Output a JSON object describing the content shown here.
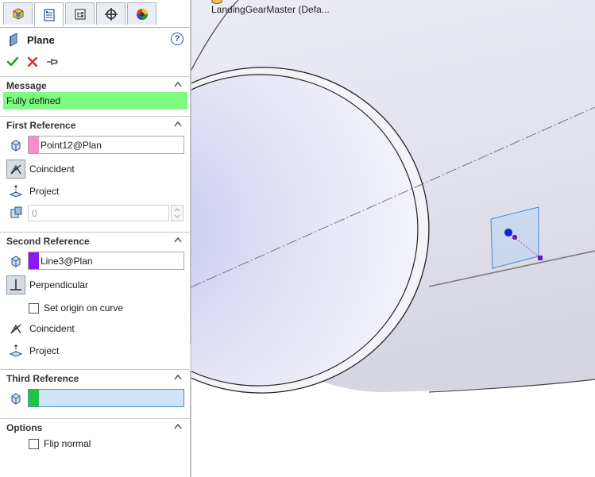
{
  "document": {
    "title": "LandingGearMaster (Defa..."
  },
  "tabs": [
    {
      "name": "feature-manager-tab",
      "icon": "feature-manager-icon"
    },
    {
      "name": "property-manager-tab",
      "icon": "property-manager-icon",
      "active": true
    },
    {
      "name": "configuration-manager-tab",
      "icon": "configuration-manager-icon"
    },
    {
      "name": "dimxpert-manager-tab",
      "icon": "dimxpert-icon"
    },
    {
      "name": "display-manager-tab",
      "icon": "display-manager-icon"
    }
  ],
  "property_manager": {
    "title": "Plane",
    "help": "?",
    "actions": {
      "ok": "ok-check-icon",
      "cancel": "cancel-x-icon",
      "pin": "pushpin-icon"
    }
  },
  "message": {
    "header": "Message",
    "text": "Fully defined",
    "color": "#7dfa80"
  },
  "first_reference": {
    "header": "First Reference",
    "selection": "Point12@Plan",
    "swatch_color": "#f58fc8",
    "options": {
      "coincident": "Coincident",
      "project": "Project"
    },
    "distance_value": "0"
  },
  "second_reference": {
    "header": "Second Reference",
    "selection": "Line3@Plan",
    "swatch_color": "#8b18f0",
    "options": {
      "perpendicular": "Perpendicular",
      "set_origin": "Set origin on curve",
      "coincident": "Coincident",
      "project": "Project"
    }
  },
  "third_reference": {
    "header": "Third Reference",
    "selection": "",
    "swatch_color": "#1fc43f"
  },
  "options": {
    "header": "Options",
    "flip_normal": "Flip normal"
  }
}
